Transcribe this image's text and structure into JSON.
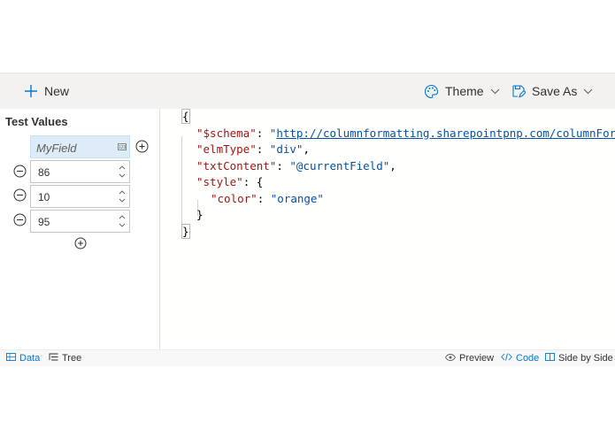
{
  "toolbar": {
    "new_label": "New",
    "theme_label": "Theme",
    "save_as_label": "Save As"
  },
  "test_values": {
    "title": "Test Values",
    "field_name": "MyField",
    "field_type_icon": "number-icon",
    "rows": [
      "86",
      "10",
      "95"
    ]
  },
  "code_lines": [
    {
      "indent": 0,
      "tokens": [
        {
          "t": "{",
          "c": "pn brace-box"
        }
      ]
    },
    {
      "indent": 1,
      "tokens": [
        {
          "t": "\"$schema\"",
          "c": "key"
        },
        {
          "t": ": ",
          "c": "pn"
        },
        {
          "t": "\"",
          "c": "str"
        },
        {
          "t": "http://columnformatting.sharepointpnp.com/columnFormattingSchema.json",
          "c": "link"
        },
        {
          "t": "\"",
          "c": "str"
        },
        {
          "t": ",",
          "c": "pn"
        }
      ]
    },
    {
      "indent": 1,
      "tokens": [
        {
          "t": "\"elmType\"",
          "c": "key"
        },
        {
          "t": ": ",
          "c": "pn"
        },
        {
          "t": "\"div\"",
          "c": "str"
        },
        {
          "t": ",",
          "c": "pn"
        }
      ]
    },
    {
      "indent": 1,
      "tokens": [
        {
          "t": "\"txtContent\"",
          "c": "key"
        },
        {
          "t": ": ",
          "c": "pn"
        },
        {
          "t": "\"@currentField\"",
          "c": "str"
        },
        {
          "t": ",",
          "c": "pn"
        }
      ]
    },
    {
      "indent": 1,
      "tokens": [
        {
          "t": "\"style\"",
          "c": "key"
        },
        {
          "t": ": {",
          "c": "pn"
        }
      ]
    },
    {
      "indent": 2,
      "tokens": [
        {
          "t": "\"color\"",
          "c": "key"
        },
        {
          "t": ": ",
          "c": "pn"
        },
        {
          "t": "\"orange\"",
          "c": "str"
        }
      ]
    },
    {
      "indent": 1,
      "tokens": [
        {
          "t": "}",
          "c": "pn"
        }
      ]
    },
    {
      "indent": 0,
      "tokens": [
        {
          "t": "}",
          "c": "pn brace-box"
        }
      ]
    }
  ],
  "statusbar": {
    "data_label": "Data",
    "tree_label": "Tree",
    "preview_label": "Preview",
    "code_label": "Code",
    "side_by_side_label": "Side by Side"
  },
  "colors": {
    "accent": "#0078d4",
    "toolbar_bg": "#f3f2f1",
    "json_key": "#a31515",
    "json_string": "#0451a5"
  }
}
